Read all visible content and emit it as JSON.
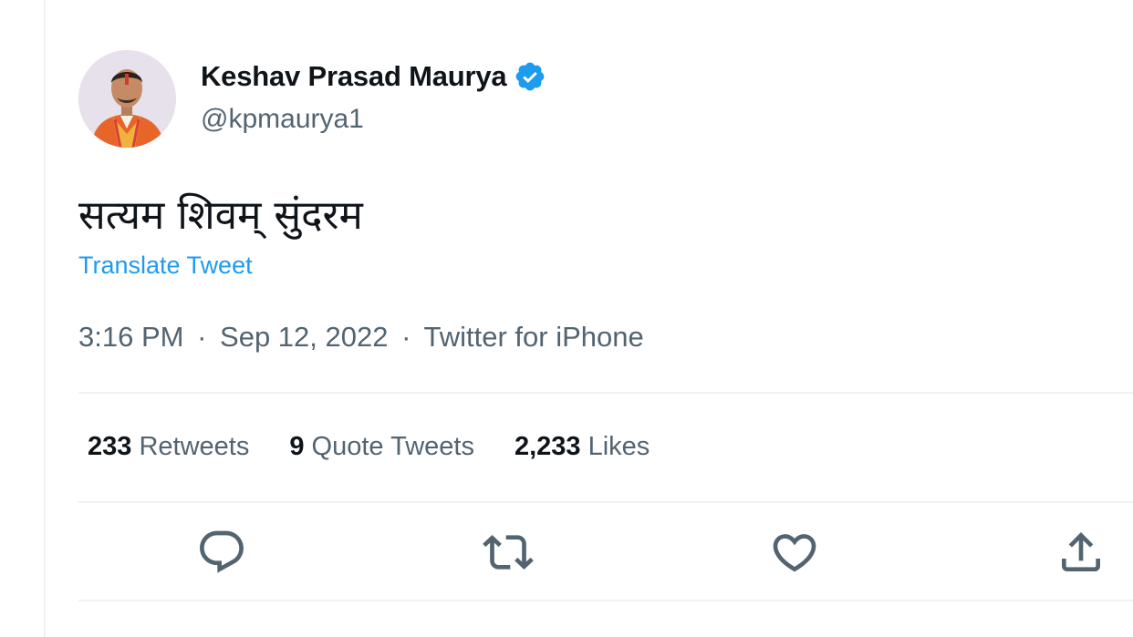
{
  "author": {
    "display_name": "Keshav Prasad Maurya",
    "handle": "@kpmaurya1",
    "verified_badge": "verified-badge-icon",
    "verified_color": "#1d9bf0"
  },
  "tweet": {
    "text": "सत्यम शिवम् सुंदरम",
    "translate_label": "Translate Tweet",
    "time": "3:16 PM",
    "date": "Sep 12, 2022",
    "source": "Twitter for iPhone",
    "separator": "·"
  },
  "stats": {
    "retweets": {
      "count": "233",
      "label": "Retweets"
    },
    "quotes": {
      "count": "9",
      "label": "Quote Tweets"
    },
    "likes": {
      "count": "2,233",
      "label": "Likes"
    }
  },
  "actions": [
    {
      "icon": "reply-icon"
    },
    {
      "icon": "retweet-icon"
    },
    {
      "icon": "like-icon"
    },
    {
      "icon": "share-icon"
    }
  ],
  "colors": {
    "accent": "#1d9bf0",
    "text_primary": "#0f1419",
    "text_secondary": "#536471",
    "divider": "#eff3f4"
  }
}
